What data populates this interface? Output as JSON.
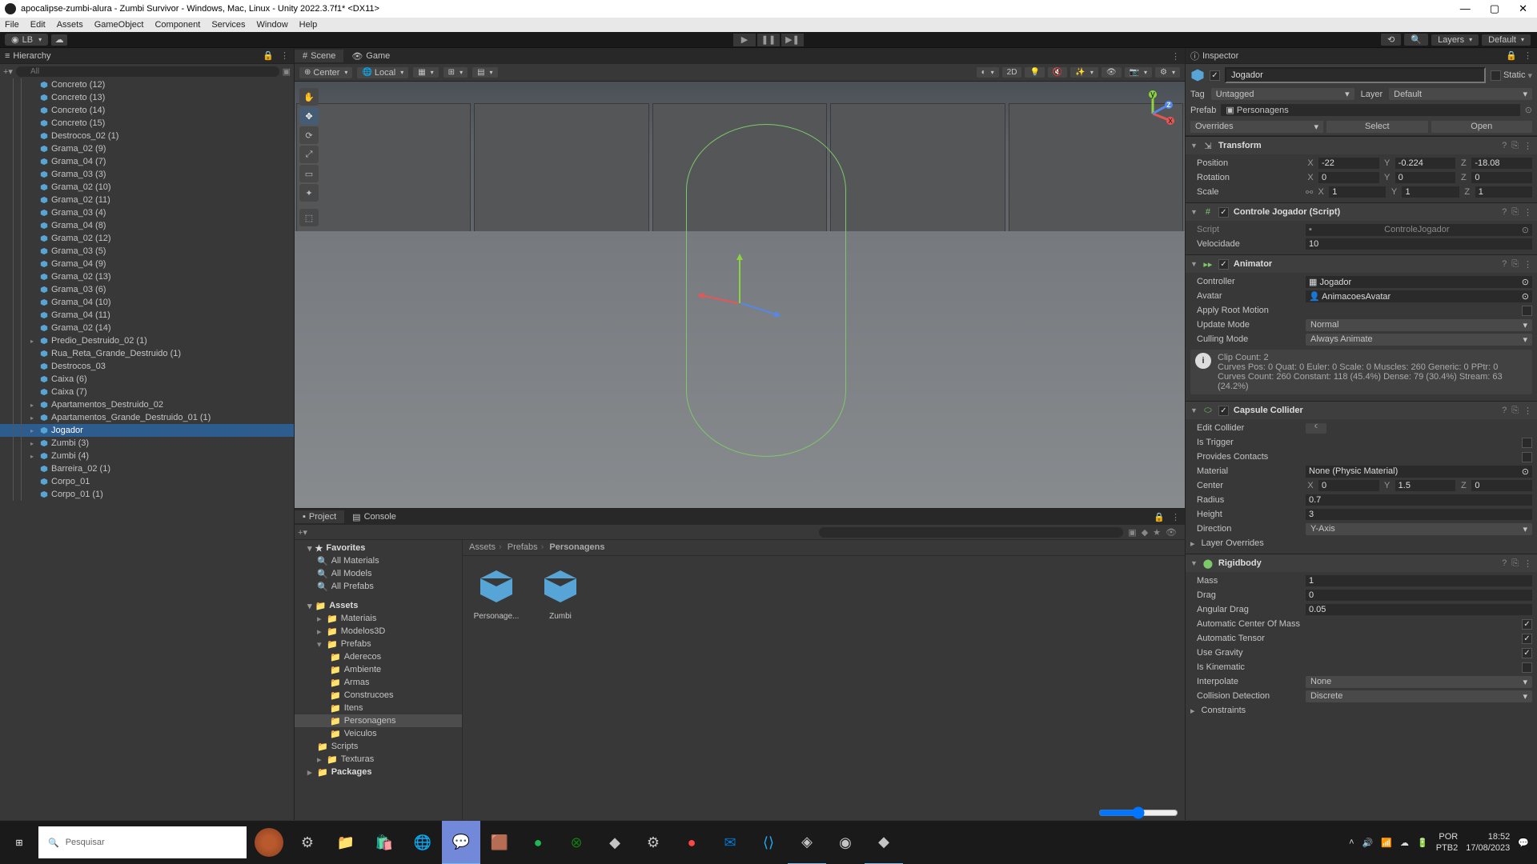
{
  "titlebar": "apocalipse-zumbi-alura - Zumbi Survivor - Windows, Mac, Linux - Unity 2022.3.7f1* <DX11>",
  "menu": [
    "File",
    "Edit",
    "Assets",
    "GameObject",
    "Component",
    "Services",
    "Window",
    "Help"
  ],
  "account": "LB",
  "toolbar_right": {
    "layers": "Layers",
    "layout": "Default"
  },
  "hierarchy": {
    "title": "Hierarchy",
    "search_placeholder": "All",
    "items": [
      "Concreto (12)",
      "Concreto (13)",
      "Concreto (14)",
      "Concreto (15)",
      "Destrocos_02 (1)",
      "Grama_02 (9)",
      "Grama_04 (7)",
      "Grama_03 (3)",
      "Grama_02 (10)",
      "Grama_02 (11)",
      "Grama_03 (4)",
      "Grama_04 (8)",
      "Grama_02 (12)",
      "Grama_03 (5)",
      "Grama_04 (9)",
      "Grama_02 (13)",
      "Grama_03 (6)",
      "Grama_04 (10)",
      "Grama_04 (11)",
      "Grama_02 (14)",
      "Predio_Destruido_02 (1)",
      "Rua_Reta_Grande_Destruido (1)",
      "Destrocos_03",
      "Caixa (6)",
      "Caixa (7)",
      "Apartamentos_Destruido_02",
      "Apartamentos_Grande_Destruido_01 (1)",
      "Jogador",
      "Zumbi (3)",
      "Zumbi (4)",
      "Barreira_02 (1)",
      "Corpo_01",
      "Corpo_01 (1)"
    ],
    "selected_index": 27,
    "foldable": [
      20,
      25,
      26,
      27,
      28,
      29
    ]
  },
  "scene": {
    "tab_scene": "Scene",
    "tab_game": "Game",
    "pivot": "Center",
    "space": "Local",
    "twod": "2D"
  },
  "project": {
    "tab_project": "Project",
    "tab_console": "Console",
    "favorites": "Favorites",
    "fav_items": [
      "All Materials",
      "All Models",
      "All Prefabs"
    ],
    "assets": "Assets",
    "asset_tree": [
      "Materiais",
      "Modelos3D",
      "Prefabs"
    ],
    "prefab_children": [
      "Aderecos",
      "Ambiente",
      "Armas",
      "Construcoes",
      "Itens",
      "Personagens",
      "Veiculos"
    ],
    "prefab_selected": "Personagens",
    "after_prefabs": [
      "Scripts",
      "Texturas"
    ],
    "packages": "Packages",
    "breadcrumb": [
      "Assets",
      "Prefabs",
      "Personagens"
    ],
    "grid_items": [
      "Personage...",
      "Zumbi"
    ]
  },
  "inspector": {
    "title": "Inspector",
    "go_name": "Jogador",
    "static": "Static",
    "tag_label": "Tag",
    "tag": "Untagged",
    "layer_label": "Layer",
    "layer": "Default",
    "prefab_label": "Prefab",
    "prefab": "Personagens",
    "overrides": "Overrides",
    "select": "Select",
    "open": "Open",
    "transform": {
      "title": "Transform",
      "position": "Position",
      "px": "-22",
      "py": "-0.224",
      "pz": "-18.08",
      "rotation": "Rotation",
      "rx": "0",
      "ry": "0",
      "rz": "0",
      "scale": "Scale",
      "sx": "1",
      "sy": "1",
      "sz": "1"
    },
    "script_comp": {
      "title": "Controle Jogador (Script)",
      "script_label": "Script",
      "script": "ControleJogador",
      "vel_label": "Velocidade",
      "vel": "10"
    },
    "animator": {
      "title": "Animator",
      "controller_label": "Controller",
      "controller": "Jogador",
      "avatar_label": "Avatar",
      "avatar": "AnimacoesAvatar",
      "root_label": "Apply Root Motion",
      "update_label": "Update Mode",
      "update": "Normal",
      "culling_label": "Culling Mode",
      "culling": "Always Animate",
      "info": "Clip Count: 2\nCurves Pos: 0 Quat: 0 Euler: 0 Scale: 0 Muscles: 260 Generic: 0 PPtr: 0\nCurves Count: 260 Constant: 118 (45.4%) Dense: 79 (30.4%) Stream: 63 (24.2%)"
    },
    "collider": {
      "title": "Capsule Collider",
      "edit_label": "Edit Collider",
      "trigger_label": "Is Trigger",
      "provides_label": "Provides Contacts",
      "material_label": "Material",
      "material": "None (Physic Material)",
      "center_label": "Center",
      "cx": "0",
      "cy": "1.5",
      "cz": "0",
      "radius_label": "Radius",
      "radius": "0.7",
      "height_label": "Height",
      "height": "3",
      "direction_label": "Direction",
      "direction": "Y-Axis",
      "layer_overrides": "Layer Overrides"
    },
    "rigidbody": {
      "title": "Rigidbody",
      "mass_label": "Mass",
      "mass": "1",
      "drag_label": "Drag",
      "drag": "0",
      "angular_label": "Angular Drag",
      "angular": "0.05",
      "auto_com": "Automatic Center Of Mass",
      "auto_tensor": "Automatic Tensor",
      "gravity": "Use Gravity",
      "kinematic": "Is Kinematic",
      "interp_label": "Interpolate",
      "interp": "None",
      "collision_label": "Collision Detection",
      "collision": "Discrete",
      "constraints": "Constraints"
    }
  },
  "taskbar": {
    "search": "Pesquisar",
    "lang": "POR",
    "kbd": "PTB2",
    "time": "18:52",
    "date": "17/08/2023"
  }
}
